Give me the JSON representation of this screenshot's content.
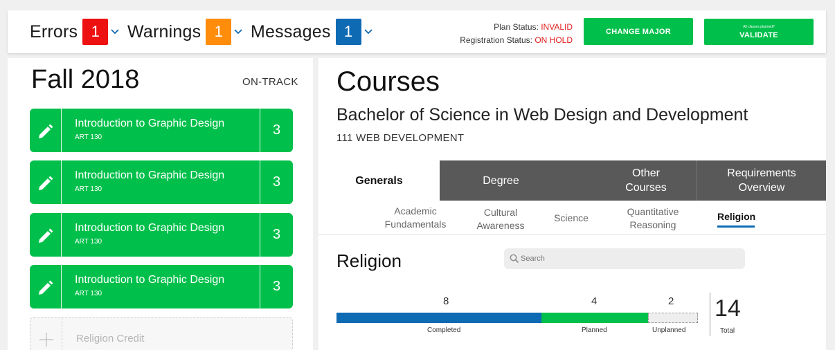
{
  "header": {
    "errors": {
      "label": "Errors",
      "count": "1",
      "color": "#ee1111"
    },
    "warnings": {
      "label": "Warnings",
      "count": "1",
      "color": "#ff8c0a"
    },
    "messages": {
      "label": "Messages",
      "count": "1",
      "color": "#0f6ab4"
    },
    "plan_status_label": "Plan Status:",
    "plan_status_value": "INVALID",
    "registration_status_label": "Registration Status:",
    "registration_status_value": "ON HOLD",
    "change_major_label": "CHANGE MAJOR",
    "validate_note": "All classes planned?",
    "validate_label": "VALIDATE"
  },
  "semester": {
    "title": "Fall 2018",
    "status": "ON-TRACK",
    "courses": [
      {
        "name": "Introduction to Graphic Design",
        "code": "ART 130",
        "credits": "3"
      },
      {
        "name": "Introduction to Graphic Design",
        "code": "ART 130",
        "credits": "3"
      },
      {
        "name": "Introduction to Graphic Design",
        "code": "ART 130",
        "credits": "3"
      },
      {
        "name": "Introduction to Graphic Design",
        "code": "ART 130",
        "credits": "3"
      }
    ],
    "placeholder": "Religion Credit"
  },
  "courses_panel": {
    "title": "Courses",
    "degree": "Bachelor of Science in Web Design and Development",
    "major": "111 WEB DEVELOPMENT",
    "tabs": [
      {
        "label": "Generals",
        "active": true
      },
      {
        "label": "Degree",
        "active": false
      },
      {
        "label": "Other Courses",
        "active": false
      },
      {
        "label": "Requirements Overview",
        "active": false
      }
    ],
    "subtabs": [
      {
        "label": "Academic Fundamentals",
        "active": false
      },
      {
        "label": "Cultural Awareness",
        "active": false
      },
      {
        "label": "Science",
        "active": false
      },
      {
        "label": "Quantitative Reasoning",
        "active": false
      },
      {
        "label": "Religion",
        "active": true
      }
    ],
    "section_title": "Religion",
    "search_placeholder": "Search",
    "progress": {
      "completed": {
        "label": "Completed",
        "value": "8",
        "color": "#0f6ab4"
      },
      "planned": {
        "label": "Planned",
        "value": "4",
        "color": "#00c04b"
      },
      "unplanned": {
        "label": "Unplanned",
        "value": "2"
      },
      "total_label": "Total",
      "total_value": "14"
    }
  },
  "icons": [
    "chevron-down-icon",
    "pencil-icon",
    "plus-icon",
    "search-icon"
  ]
}
